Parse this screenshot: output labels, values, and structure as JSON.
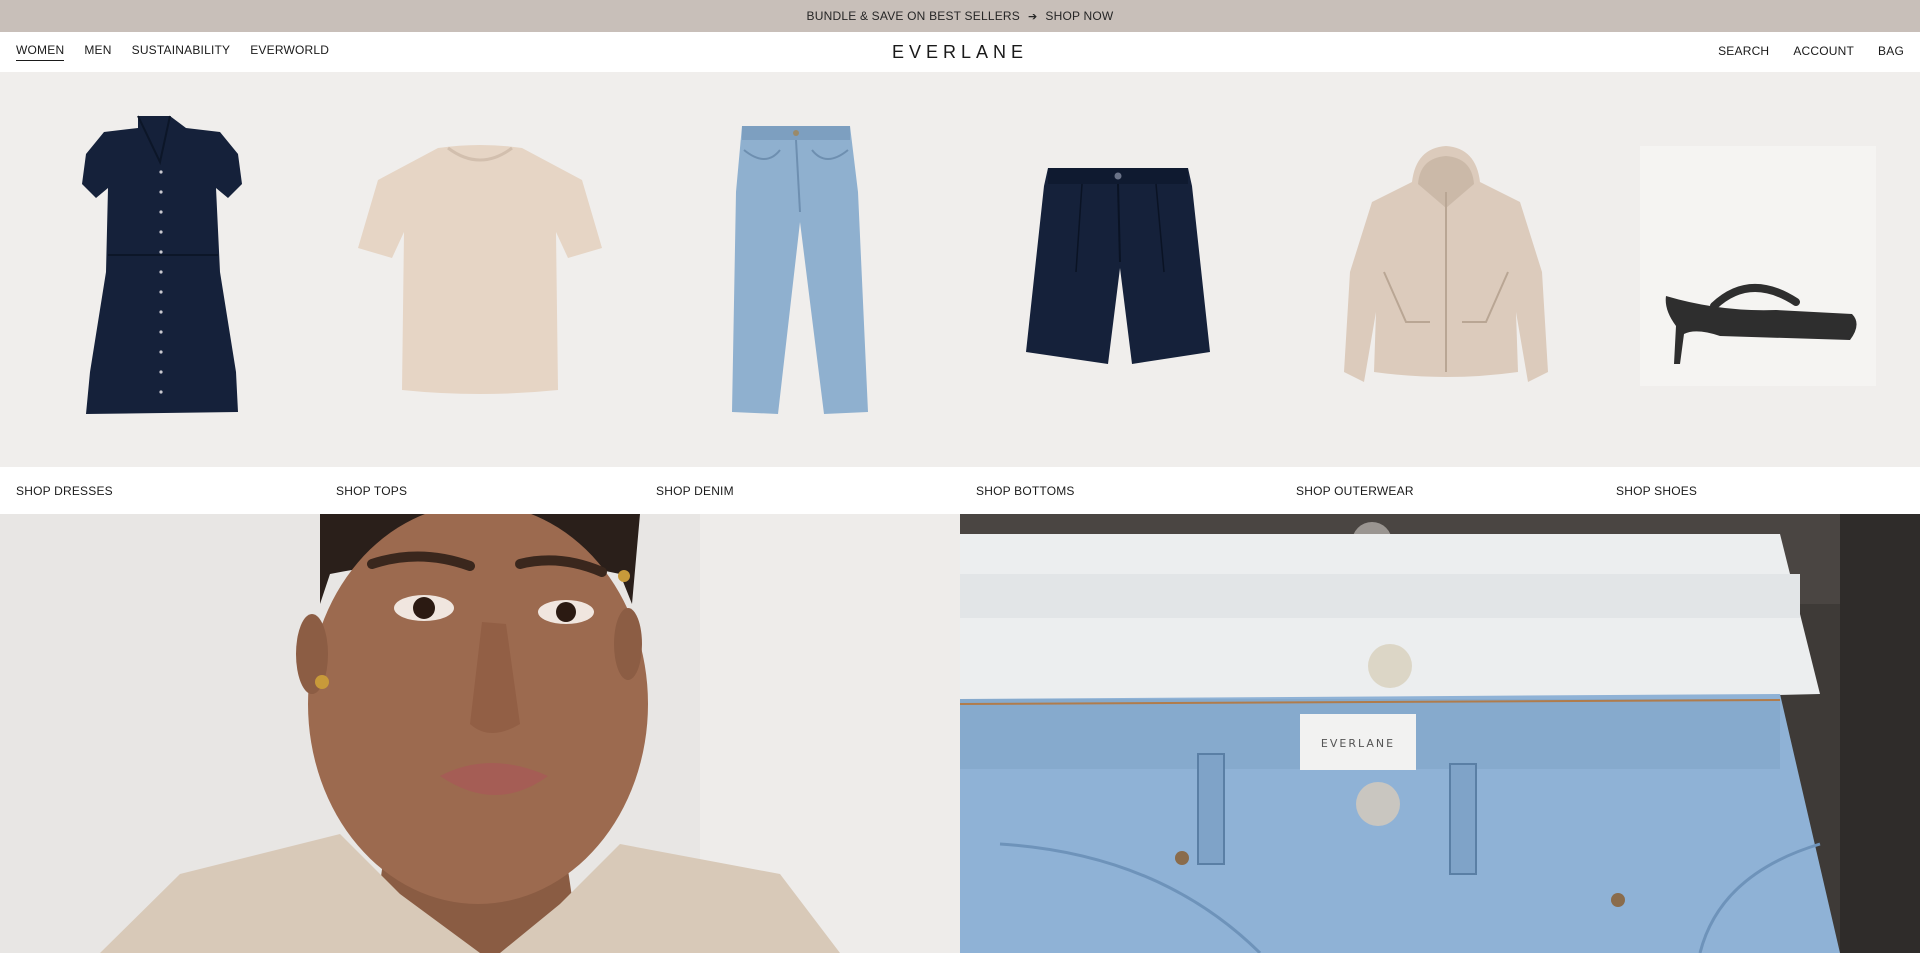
{
  "promo": {
    "text": "BUNDLE & SAVE ON BEST SELLERS",
    "arrow_icon": "arrow-right-icon",
    "cta": "SHOP NOW"
  },
  "nav": {
    "left": [
      "WOMEN",
      "MEN",
      "SUSTAINABILITY",
      "EVERWORLD"
    ],
    "active": "WOMEN",
    "logo": "EVERLANE",
    "right": [
      "SEARCH",
      "ACCOUNT",
      "BAG"
    ]
  },
  "categories": [
    {
      "label": "SHOP DRESSES",
      "image": "navy-dress"
    },
    {
      "label": "SHOP TOPS",
      "image": "beige-tshirt"
    },
    {
      "label": "SHOP DENIM",
      "image": "light-wash-jeans"
    },
    {
      "label": "SHOP BOTTOMS",
      "image": "navy-shorts"
    },
    {
      "label": "SHOP OUTERWEAR",
      "image": "beige-windbreaker"
    },
    {
      "label": "SHOP SHOES",
      "image": "black-kitten-heel-sandal"
    }
  ],
  "hero": {
    "left_image": "model-portrait-linen-shirt",
    "right_image": "stacked-denim-waistbands",
    "right_label_text": "EVERLANE"
  },
  "colors": {
    "promo_bg": "#c8bfb9",
    "tile_bg": "#f0eeec",
    "navy": "#15213a",
    "beige": "#e6d5c5",
    "denim": "#8fb0cf"
  }
}
